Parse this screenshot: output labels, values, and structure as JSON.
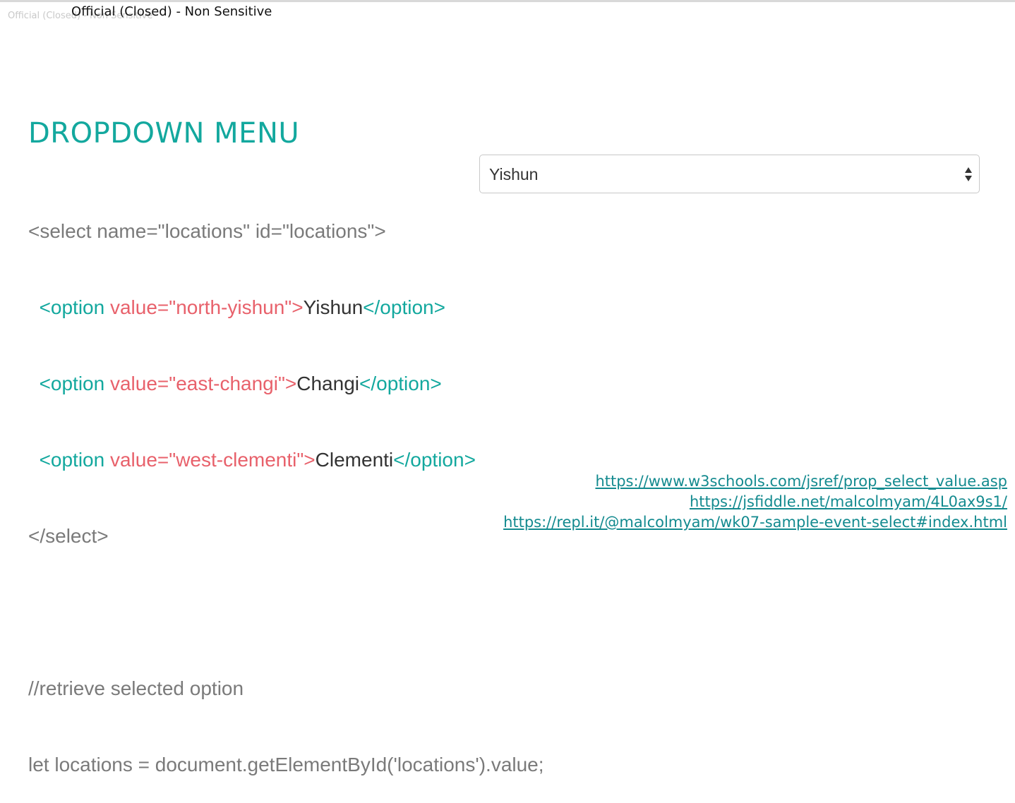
{
  "header": {
    "classification_faint": "Official (Closed) - Non Sensitive",
    "classification": "Official (Closed) - Non Sensitive"
  },
  "slide": {
    "title": "DROPDOWN MENU"
  },
  "code": {
    "select_open": "<select name=\"locations\" id=\"locations\">",
    "options": [
      {
        "indent": "  ",
        "open_tag": "<option",
        "attr": " value=\"north-yishun\">",
        "text": "Yishun",
        "close_tag": "</option>"
      },
      {
        "indent": "  ",
        "open_tag": "<option",
        "attr": " value=\"east-changi\">",
        "text": "Changi",
        "close_tag": "</option>"
      },
      {
        "indent": "  ",
        "open_tag": "<option",
        "attr": " value=\"west-clementi\">",
        "text": "Clementi",
        "close_tag": "</option>"
      }
    ],
    "select_close": "</select>",
    "comment": "//retrieve selected option",
    "js_line": "let locations = document.getElementById('locations').value;"
  },
  "dropdown": {
    "selected_value": "Yishun",
    "icon": "chevron-up-down-icon"
  },
  "links": [
    "https://www.w3schools.com/jsref/prop_select_value.asp",
    "https://jsfiddle.net/malcolmyam/4L0ax9s1/",
    "https://repl.it/@malcolmyam/wk07-sample-event-select#index.html"
  ],
  "colors": {
    "accent": "#13a89e",
    "attribute": "#e8616b",
    "code_gray": "#7a7a7a",
    "link": "#138a8f"
  }
}
